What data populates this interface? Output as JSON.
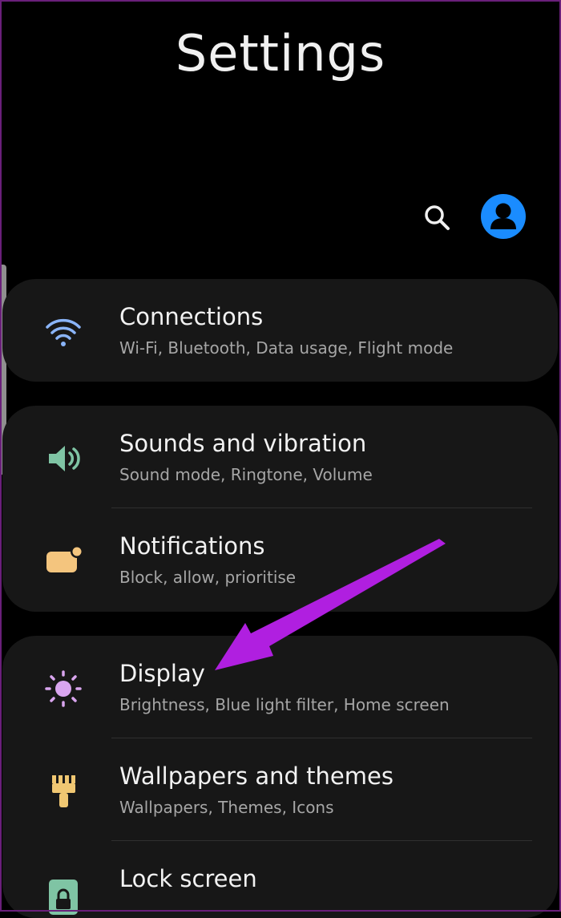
{
  "header": {
    "title": "Settings"
  },
  "toolbar": {
    "search_icon": "search-icon",
    "profile_icon": "account-icon"
  },
  "colors": {
    "accent_profile": "#1a8cff",
    "connections_icon": "#8ab4f8",
    "sounds_icon": "#7fc4a4",
    "notifications_icon": "#f4c57e",
    "display_icon": "#d9a5ef",
    "wallpapers_icon": "#f0c772",
    "lock_icon": "#7fc4a4",
    "annotation_arrow": "#b01fe0"
  },
  "settings": {
    "connections": {
      "title": "Connections",
      "subtitle": "Wi-Fi, Bluetooth, Data usage, Flight mode",
      "icon": "wifi-icon"
    },
    "sounds": {
      "title": "Sounds and vibration",
      "subtitle": "Sound mode, Ringtone, Volume",
      "icon": "speaker-icon"
    },
    "notifications": {
      "title": "Notifications",
      "subtitle": "Block, allow, prioritise",
      "icon": "notification-icon"
    },
    "display": {
      "title": "Display",
      "subtitle": "Brightness, Blue light filter, Home screen",
      "icon": "sun-icon"
    },
    "wallpapers": {
      "title": "Wallpapers and themes",
      "subtitle": "Wallpapers, Themes, Icons",
      "icon": "paintbrush-icon"
    },
    "lockscreen": {
      "title": "Lock screen",
      "subtitle": "",
      "icon": "lock-icon"
    }
  }
}
